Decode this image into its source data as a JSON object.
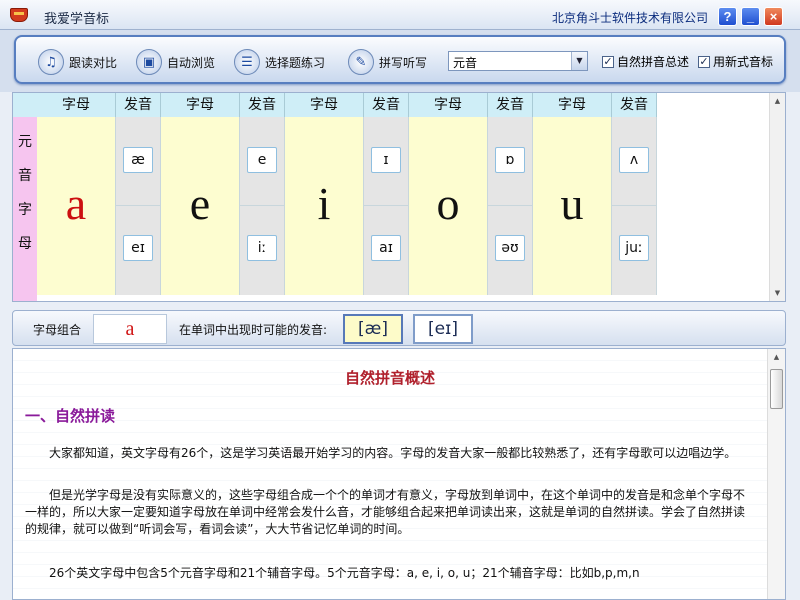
{
  "window": {
    "title": "我爱学音标",
    "company": "北京角斗士软件技术有限公司",
    "help_label": "?",
    "minimize_label": "_",
    "close_label": "×"
  },
  "toolbar": {
    "buttons": [
      {
        "label": "跟读对比",
        "icon": "speaker-icon"
      },
      {
        "label": "自动浏览",
        "icon": "browse-icon"
      },
      {
        "label": "选择题练习",
        "icon": "quiz-icon"
      },
      {
        "label": "拼写听写",
        "icon": "pencil-icon"
      }
    ],
    "select": {
      "value": "元音"
    },
    "checkboxes": [
      {
        "label": "自然拼音总述",
        "checked": true
      },
      {
        "label": "用新式音标",
        "checked": true
      }
    ]
  },
  "letter_table": {
    "side_label": [
      "元",
      "音",
      "字",
      "母"
    ],
    "letter_header": "字母",
    "sound_header": "发音",
    "columns": [
      {
        "letter": "a",
        "sounds": [
          "æ",
          "eɪ"
        ],
        "highlighted": true
      },
      {
        "letter": "e",
        "sounds": [
          "e",
          "iː"
        ],
        "highlighted": false
      },
      {
        "letter": "i",
        "sounds": [
          "ɪ",
          "aɪ"
        ],
        "highlighted": false
      },
      {
        "letter": "o",
        "sounds": [
          "ɒ",
          "əʊ"
        ],
        "highlighted": false
      },
      {
        "letter": "u",
        "sounds": [
          "ʌ",
          "juː"
        ],
        "highlighted": false
      }
    ]
  },
  "combo": {
    "label": "字母组合",
    "value": "a",
    "hint": "在单词中出现时可能的发音:",
    "pronunciations": [
      {
        "text": "[æ]",
        "selected": true
      },
      {
        "text": "[eɪ]",
        "selected": false
      }
    ]
  },
  "document": {
    "title": "自然拼音概述",
    "heading": "一、自然拼读",
    "paragraphs": [
      "大家都知道，英文字母有26个，这是学习英语最开始学习的内容。字母的发音大家一般都比较熟悉了，还有字母歌可以边唱边学。",
      "但是光学字母是没有实际意义的，这些字母组合成一个个的单词才有意义，字母放到单词中，在这个单词中的发音是和念单个字母不一样的，所以大家一定要知道字母放在单词中经常会发什么音，才能够组合起来把单词读出来，这就是单词的自然拼读。学会了自然拼读的规律，就可以做到“听词会写，看词会读”，大大节省记忆单词的时间。",
      "26个英文字母中包含5个元音字母和21个辅音字母。5个元音字母：a, e, i, o, u；21个辅音字母：比如b,p,m,n"
    ]
  },
  "colors": {
    "letter_bg": "#fdfdd0",
    "sound_bg": "#e5e5e5",
    "header_bg": "#cfeef7",
    "side_bg": "#f6c5ef",
    "accent_red": "#cc1010",
    "heading_purple": "#8a1a9a"
  }
}
